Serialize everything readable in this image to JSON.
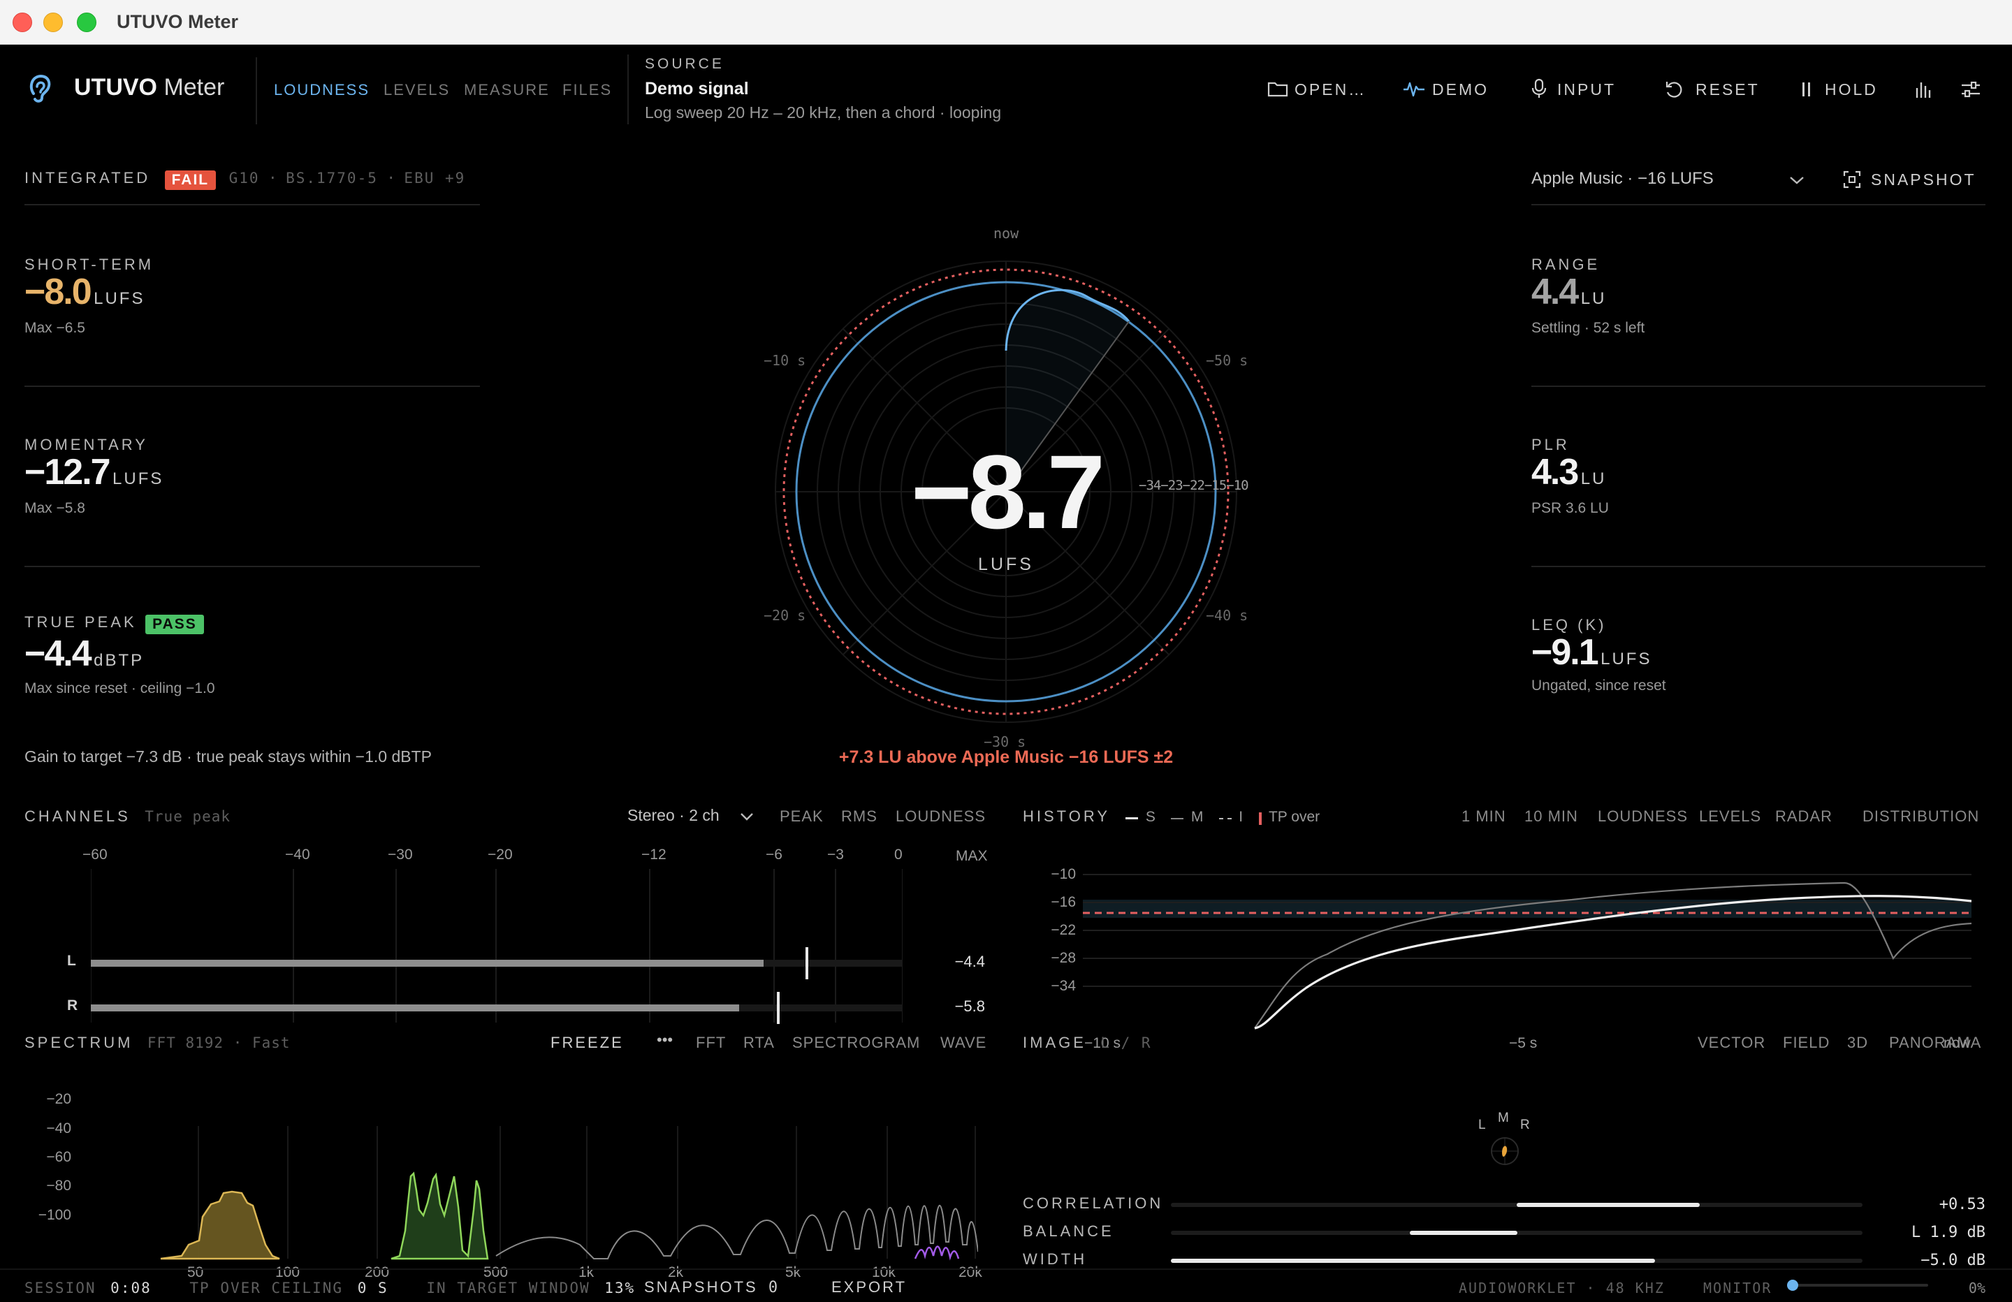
{
  "window": {
    "title": "UTUVO Meter"
  },
  "header": {
    "brand_a": "UTUVO",
    "brand_b": "Meter",
    "nav": [
      "LOUDNESS",
      "LEVELS",
      "MEASURE",
      "FILES"
    ],
    "source_label": "SOURCE",
    "source_title": "Demo signal",
    "source_desc": "Log sweep 20 Hz – 20 kHz, then a chord · looping",
    "toolbar": {
      "open": "OPEN…",
      "demo": "DEMO",
      "input": "INPUT",
      "reset": "RESET",
      "hold": "HOLD"
    }
  },
  "integrated": {
    "label": "INTEGRATED",
    "badge": "FAIL",
    "g10": "G10",
    "standard": "BS.1770-5",
    "ebu": "EBU +9",
    "value": "−8.7",
    "unit": "LUFS",
    "target_select": "Apple Music · −16 LUFS",
    "snapshot": "SNAPSHOT",
    "status": "+7.3 LU above Apple Music −16 LUFS ±2",
    "radar_now": "now",
    "radar_10s": "−10 s",
    "radar_20s": "−20 s",
    "radar_30s": "−30 s",
    "radar_40s": "−40 s",
    "radar_50s": "−50 s",
    "radar_scale": "−34−23−22−15−10"
  },
  "short_term": {
    "label": "SHORT-TERM",
    "value": "−8.0",
    "unit": "LUFS",
    "sub": "Max −6.5"
  },
  "momentary": {
    "label": "MOMENTARY",
    "value": "−12.7",
    "unit": "LUFS",
    "sub": "Max −5.8"
  },
  "true_peak": {
    "label": "TRUE PEAK",
    "badge": "PASS",
    "value": "−4.4",
    "unit": "dBTP",
    "sub": "Max since reset · ceiling −1.0"
  },
  "gain_note": "Gain to target −7.3 dB · true peak stays within −1.0 dBTP",
  "range": {
    "label": "RANGE",
    "value": "4.4",
    "unit": "LU",
    "sub": "Settling · 52 s left"
  },
  "plr": {
    "label": "PLR",
    "value": "4.3",
    "unit": "LU",
    "sub": "PSR 3.6 LU"
  },
  "leq": {
    "label": "LEQ (K)",
    "value": "−9.1",
    "unit": "LUFS",
    "sub": "Ungated, since reset"
  },
  "channels": {
    "label": "CHANNELS",
    "sublabel": "True peak",
    "layout": "Stereo · 2 ch",
    "modes": [
      "PEAK",
      "RMS",
      "LOUDNESS"
    ],
    "scale": [
      "−60",
      "−40",
      "−30",
      "−20",
      "−12",
      "−6",
      "−3",
      "0"
    ],
    "max_label": "MAX",
    "rows": [
      {
        "name": "L",
        "level_db": -6.5,
        "peak_db": -4.4,
        "max": "−4.4"
      },
      {
        "name": "R",
        "level_db": -7.7,
        "peak_db": -5.8,
        "max": "−5.8"
      }
    ]
  },
  "history": {
    "label": "HISTORY",
    "legend": [
      "S",
      "M",
      "I",
      "TP over"
    ],
    "ranges": [
      "1 MIN",
      "10 MIN"
    ],
    "views": [
      "LOUDNESS",
      "LEVELS",
      "RADAR",
      "DISTRIBUTION"
    ],
    "y_ticks": [
      "−10",
      "−16",
      "−22",
      "−28",
      "−34"
    ],
    "x_ticks": [
      "−10 s",
      "−5 s",
      "now"
    ]
  },
  "spectrum": {
    "label": "SPECTRUM",
    "sublabel": "FFT 8192 · Fast",
    "freeze": "FREEZE",
    "more": "•••",
    "modes": [
      "FFT",
      "RTA",
      "SPECTROGRAM",
      "WAVE"
    ],
    "y_ticks": [
      "−20",
      "−40",
      "−60",
      "−80",
      "−100"
    ],
    "x_ticks": [
      "50",
      "100",
      "200",
      "500",
      "1k",
      "2k",
      "5k",
      "10k",
      "20k"
    ]
  },
  "image": {
    "label": "IMAGE",
    "sublabel": "L / R",
    "modes": [
      "VECTOR",
      "FIELD",
      "3D",
      "PANORAMA"
    ],
    "vec_l": "L",
    "vec_m": "M",
    "vec_r": "R",
    "rows": [
      {
        "name": "CORRELATION",
        "value": "+0.53",
        "center": 0.53
      },
      {
        "name": "BALANCE",
        "value": "L 1.9 dB"
      },
      {
        "name": "WIDTH",
        "value": "−5.0 dB",
        "level": 0.7
      }
    ]
  },
  "footer": {
    "session_label": "SESSION",
    "session": "0:08",
    "tp_label": "TP OVER CEILING",
    "tp": "0 S",
    "window_label": "IN TARGET WINDOW",
    "window": "13%",
    "snapshots_label": "SNAPSHOTS",
    "snapshots": "0",
    "export": "EXPORT",
    "engine": "AUDIOWORKLET · 48 KHZ",
    "monitor": "MONITOR",
    "monitor_level": 0,
    "monitor_value": "0%"
  },
  "colors": {
    "accent": "#6cb4ee",
    "fail": "#e5533d",
    "pass": "#4cc267",
    "short_term": "#e8b46a",
    "target_line": "#e46060"
  }
}
